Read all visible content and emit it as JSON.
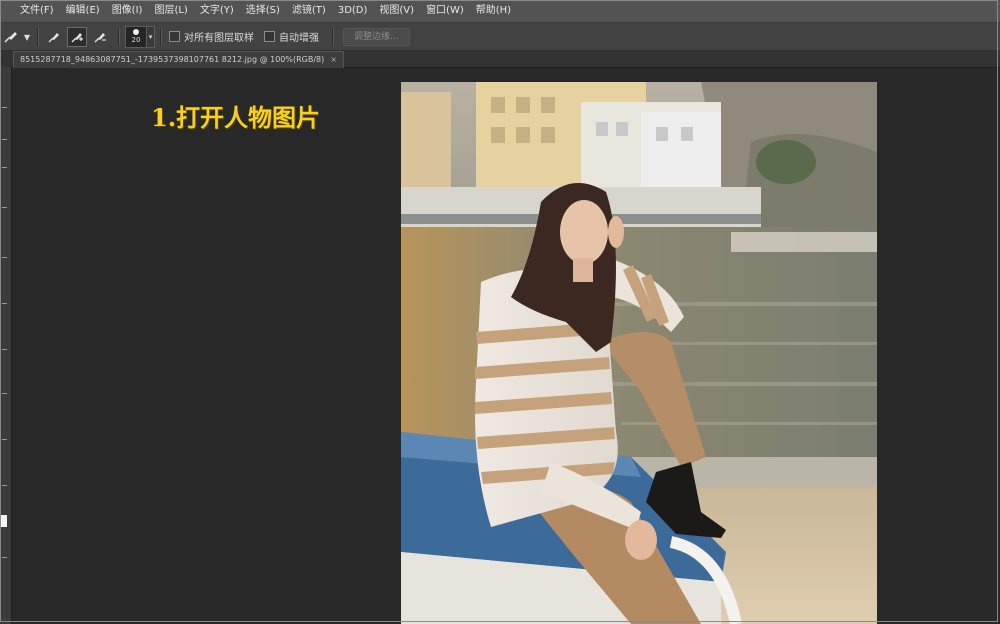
{
  "menu": {
    "items": [
      "文件(F)",
      "编辑(E)",
      "图像(I)",
      "图层(L)",
      "文字(Y)",
      "选择(S)",
      "滤镜(T)",
      "3D(D)",
      "视图(V)",
      "窗口(W)",
      "帮助(H)"
    ]
  },
  "options": {
    "tool_icon": "quick-selection-brush-icon",
    "brush_size": "20",
    "sample_all_layers_label": "对所有图层取样",
    "auto_enhance_label": "自动增强",
    "refine_edge_label": "调整边缘..."
  },
  "document": {
    "tab_title": "8515287718_94863087751_-1739537398107761 8212.jpg @ 100%(RGB/8)",
    "close_glyph": "×"
  },
  "annotation": {
    "text": "1.打开人物图片",
    "color": "#f7d11e"
  },
  "colors": {
    "menubar_bg": "#535353",
    "optbar_bg": "#424242",
    "workspace_bg": "#282828"
  }
}
